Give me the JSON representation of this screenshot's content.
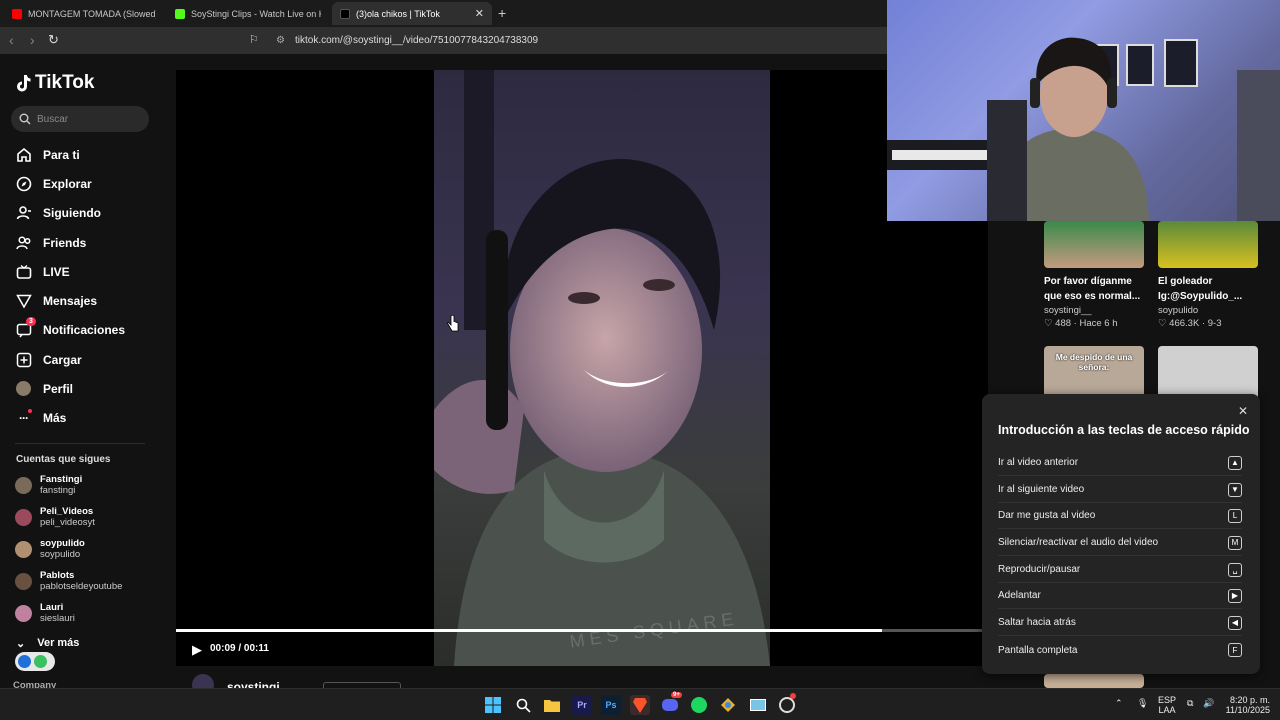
{
  "browser": {
    "tabs": [
      {
        "title": "MONTAGEM TOMADA (Slowed) | La",
        "favicon_color": "#ff0000",
        "active": false
      },
      {
        "title": "SoyStingi Clips - Watch Live on Kick",
        "favicon_color": "#53fc18",
        "active": false
      },
      {
        "title": "(3)ola chikos | TikTok",
        "favicon_color": "#000000",
        "active": true
      }
    ],
    "new_tab_icon": "plus-icon",
    "url": "tiktok.com/@soystingi__/video/7510077843204738309"
  },
  "sidebar": {
    "logo_text": "TikTok",
    "search_placeholder": "Buscar",
    "nav": [
      {
        "label": "Para ti",
        "icon": "home-icon"
      },
      {
        "label": "Explorar",
        "icon": "compass-icon"
      },
      {
        "label": "Siguiendo",
        "icon": "following-icon"
      },
      {
        "label": "Friends",
        "icon": "friends-icon"
      },
      {
        "label": "LIVE",
        "icon": "live-icon"
      },
      {
        "label": "Mensajes",
        "icon": "send-icon"
      },
      {
        "label": "Notificaciones",
        "icon": "inbox-icon",
        "badge": "3"
      },
      {
        "label": "Cargar",
        "icon": "upload-icon"
      },
      {
        "label": "Perfil",
        "icon": "avatar"
      },
      {
        "label": "Más",
        "icon": "more-icon"
      }
    ],
    "following_title": "Cuentas que sigues",
    "following": [
      {
        "name": "Fanstingi",
        "handle": "fanstingi",
        "color": "#7a6a5a"
      },
      {
        "name": "Peli_Videos",
        "handle": "peli_videosyt",
        "color": "#9a4a5a"
      },
      {
        "name": "soypulido",
        "handle": "soypulido",
        "color": "#b09070"
      },
      {
        "name": "Pablots",
        "handle": "pablotseldeyoutube",
        "color": "#6a5040"
      },
      {
        "name": "Lauri",
        "handle": "sieslauri",
        "color": "#c080a0"
      }
    ],
    "see_more": "Ver más",
    "company": "Company"
  },
  "player": {
    "progress": 0.87,
    "time": "00:09 / 00:11",
    "video_text": "MES SQUARE",
    "below_name": "soystingi"
  },
  "recommended": [
    {
      "title": "Por favor díganme que eso es normal...",
      "user": "soystingi__",
      "likes": "488",
      "age": "Hace 6 h",
      "thumb_color": "#3a8a4a"
    },
    {
      "title": "El goleador Ig:@Soypulido_...",
      "user": "soypulido",
      "likes": "466.3K",
      "age": "9-3",
      "thumb_color": "#d8c020"
    },
    {
      "thumb_title": "Me despido de una señora:",
      "thumb_color": "#b8a898"
    },
    {
      "thumb_color": "#d0d0d0"
    }
  ],
  "shortcuts": {
    "title": "Introducción a las teclas de acceso rápido",
    "items": [
      {
        "label": "Ir al video anterior",
        "key": "▲"
      },
      {
        "label": "Ir al siguiente video",
        "key": "▼"
      },
      {
        "label": "Dar me gusta al video",
        "key": "L"
      },
      {
        "label": "Silenciar/reactivar el audio del video",
        "key": "M"
      },
      {
        "label": "Reproducir/pausar",
        "key": "␣"
      },
      {
        "label": "Adelantar",
        "key": "▶"
      },
      {
        "label": "Saltar hacia atrás",
        "key": "◀"
      },
      {
        "label": "Pantalla completa",
        "key": "F"
      }
    ]
  },
  "taskbar": {
    "lang1": "ESP",
    "lang2": "LAA",
    "time": "8:20 p. m.",
    "date": "11/10/2025",
    "discord_badge": "9+"
  }
}
